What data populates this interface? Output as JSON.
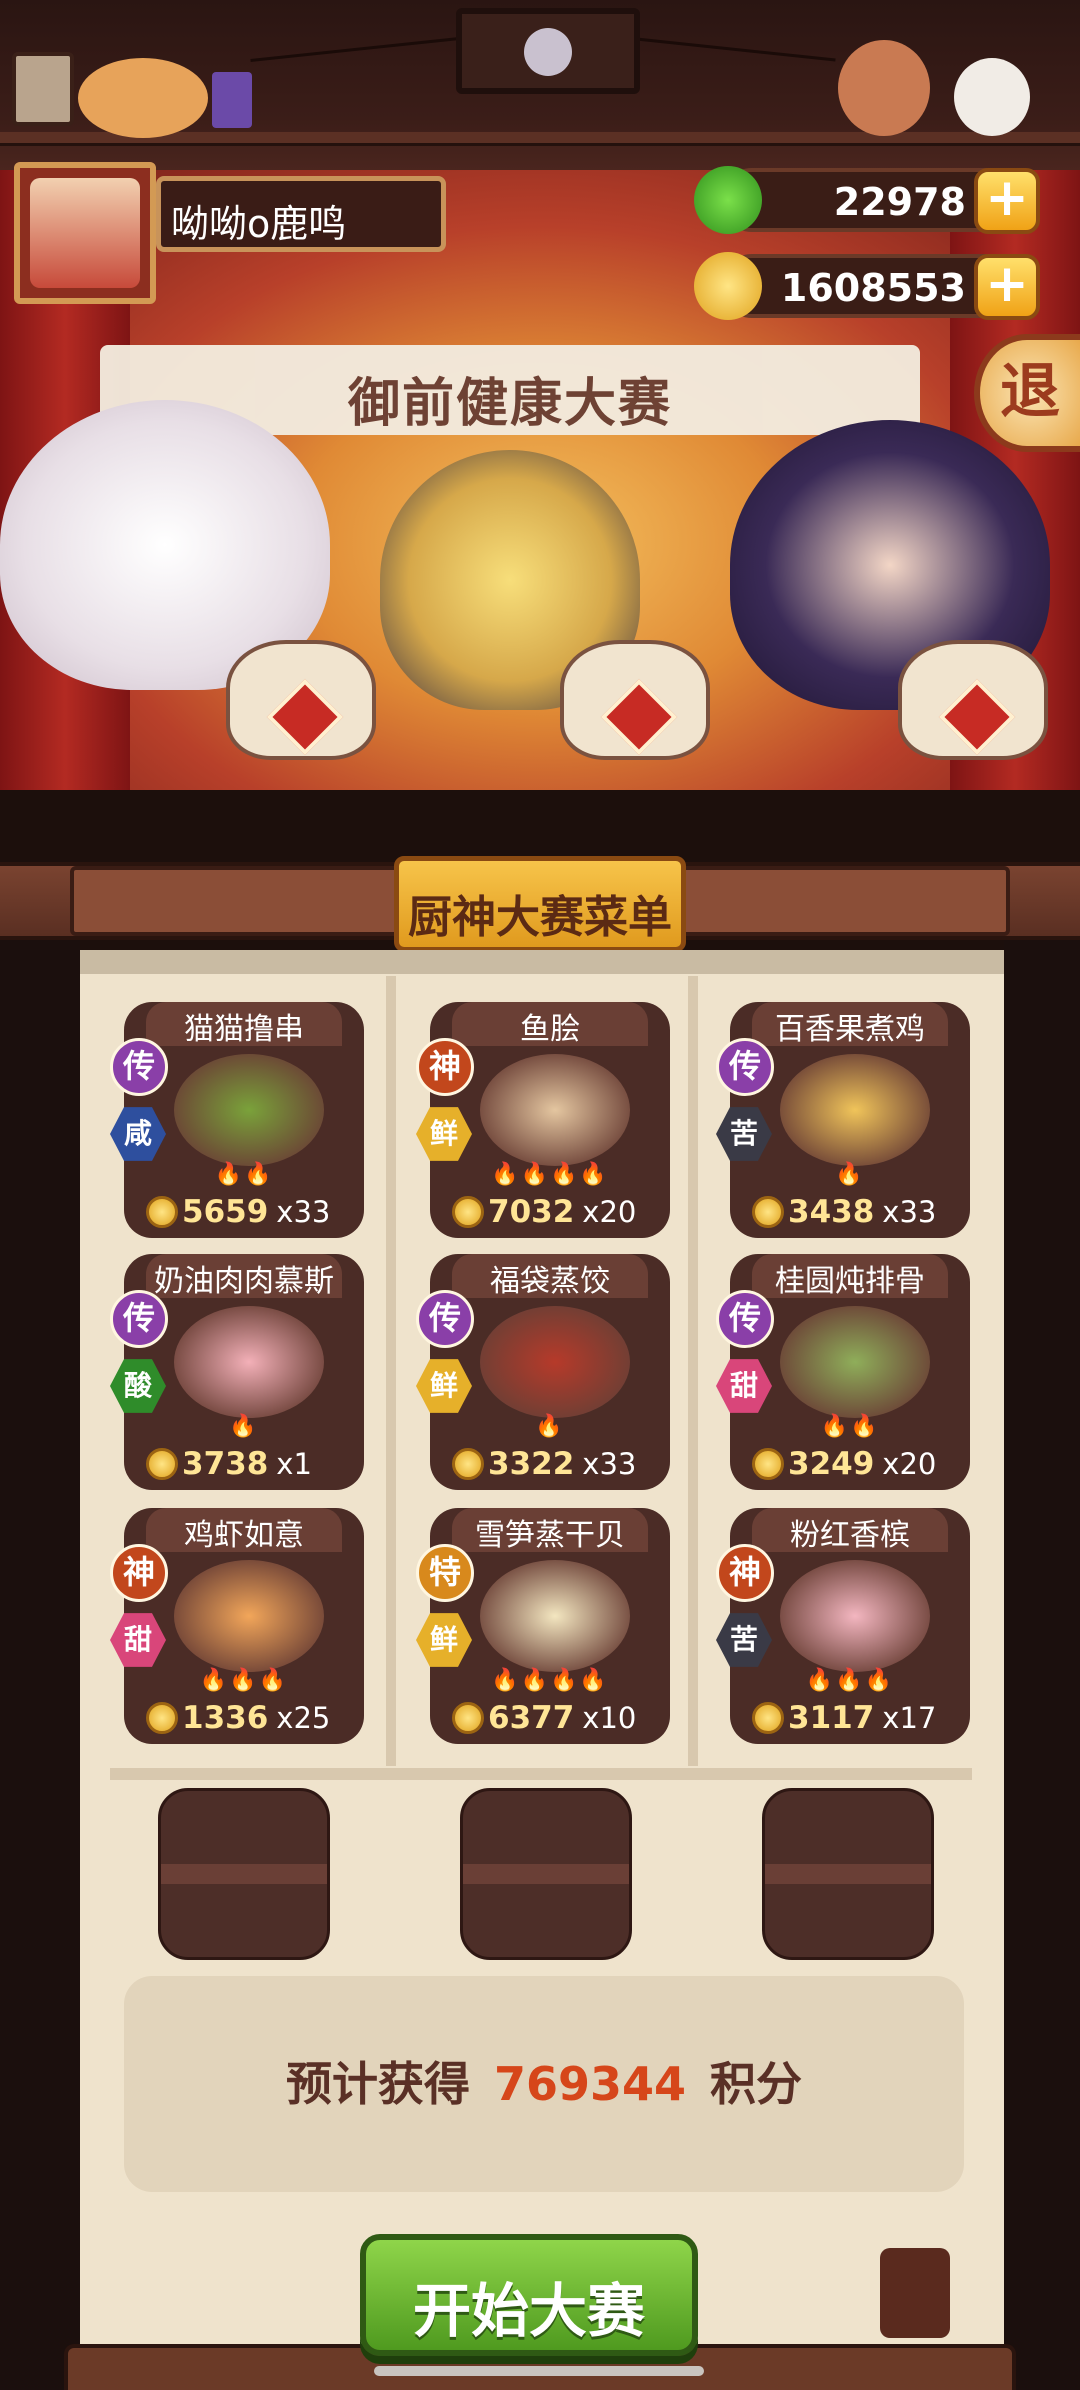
{
  "player": {
    "name": "呦呦o鹿鸣"
  },
  "resources": [
    {
      "name": "jade",
      "value": "22978",
      "icon": "jade-icon",
      "color": "#3fb52a"
    },
    {
      "name": "coins",
      "value": "1608553",
      "icon": "coin-icon",
      "color": "#f2c02e"
    }
  ],
  "exit_label": "退",
  "stage_banner": "御前健康大赛",
  "menu_title": "厨神大赛菜单",
  "dishes": [
    {
      "name": "猫猫撸串",
      "rank": "传",
      "taste": "咸",
      "flames": "🔥🔥",
      "price": "5659",
      "count": "x33"
    },
    {
      "name": "鱼脍",
      "rank": "神",
      "taste": "鲜",
      "flames": "🔥🔥🔥🔥",
      "price": "7032",
      "count": "x20"
    },
    {
      "name": "百香果煮鸡",
      "rank": "传",
      "taste": "苦",
      "flames": "🔥",
      "price": "3438",
      "count": "x33"
    },
    {
      "name": "奶油肉肉慕斯",
      "rank": "传",
      "taste": "酸",
      "flames": "🔥",
      "price": "3738",
      "count": "x1"
    },
    {
      "name": "福袋蒸饺",
      "rank": "传",
      "taste": "鲜",
      "flames": "🔥",
      "price": "3322",
      "count": "x33"
    },
    {
      "name": "桂圆炖排骨",
      "rank": "传",
      "taste": "甜",
      "flames": "🔥🔥",
      "price": "3249",
      "count": "x20"
    },
    {
      "name": "鸡虾如意",
      "rank": "神",
      "taste": "甜",
      "flames": "🔥🔥🔥",
      "price": "1336",
      "count": "x25"
    },
    {
      "name": "雪笋蒸干贝",
      "rank": "特",
      "taste": "鲜",
      "flames": "🔥🔥🔥🔥",
      "price": "6377",
      "count": "x10"
    },
    {
      "name": "粉红香槟",
      "rank": "神",
      "taste": "苦",
      "flames": "🔥🔥🔥",
      "price": "3117",
      "count": "x17"
    }
  ],
  "rank_colors": {
    "传": "#8a3fa8",
    "神": "#c2471c",
    "特": "#d8891c"
  },
  "taste_colors": {
    "咸": "#2e4f9e",
    "鲜": "#e6b02a",
    "苦": "#3a3a46",
    "酸": "#2f8c2a",
    "甜": "#d9467a"
  },
  "result": {
    "prefix": "预计获得",
    "value": "769344",
    "suffix": "积分"
  },
  "start_label": "开始大赛"
}
